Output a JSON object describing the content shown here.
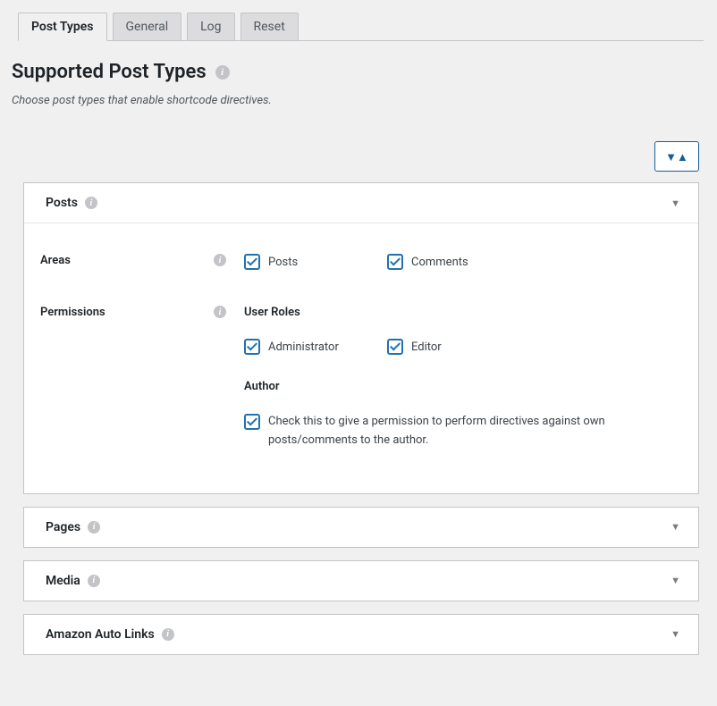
{
  "tabs": [
    {
      "label": "Post Types",
      "active": true
    },
    {
      "label": "General",
      "active": false
    },
    {
      "label": "Log",
      "active": false
    },
    {
      "label": "Reset",
      "active": false
    }
  ],
  "page": {
    "title": "Supported Post Types",
    "description": "Choose post types that enable shortcode directives."
  },
  "panels": {
    "posts": {
      "title": "Posts",
      "areas_label": "Areas",
      "areas": [
        {
          "label": "Posts",
          "checked": true
        },
        {
          "label": "Comments",
          "checked": true
        }
      ],
      "permissions_label": "Permissions",
      "user_roles_heading": "User Roles",
      "user_roles": [
        {
          "label": "Administrator",
          "checked": true
        },
        {
          "label": "Editor",
          "checked": true
        }
      ],
      "author_heading": "Author",
      "author_check_text": "Check this to give a permission to perform directives against own posts/comments to the author.",
      "author_checked": true
    },
    "pages": {
      "title": "Pages"
    },
    "media": {
      "title": "Media"
    },
    "amazon": {
      "title": "Amazon Auto Links"
    }
  }
}
